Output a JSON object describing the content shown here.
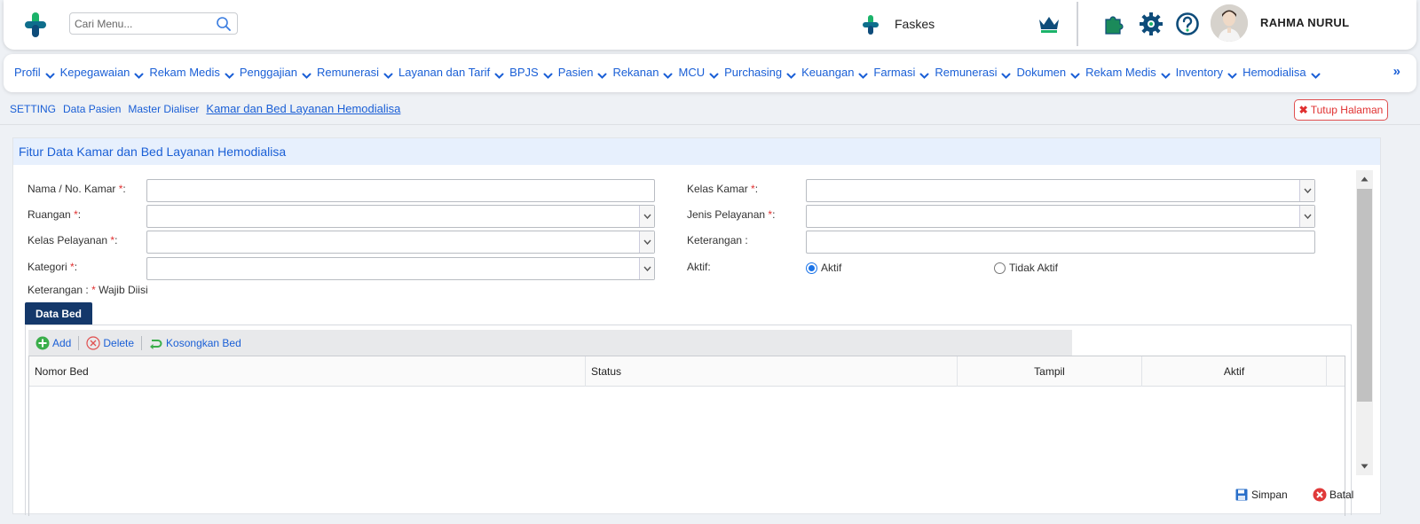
{
  "header": {
    "search_placeholder": "Cari Menu...",
    "facility_label": "Faskes",
    "user_name": "RAHMA NURUL"
  },
  "menu": {
    "items": [
      "Profil",
      "Kepegawaian",
      "Rekam Medis",
      "Penggajian",
      "Remunerasi",
      "Layanan dan Tarif",
      "BPJS",
      "Pasien",
      "Rekanan",
      "MCU",
      "Purchasing",
      "Keuangan",
      "Farmasi",
      "Remunerasi",
      "Dokumen",
      "Rekam Medis",
      "Inventory",
      "Hemodialisa"
    ],
    "more": "»"
  },
  "breadcrumb": {
    "items": [
      "SETTING",
      "Data Pasien",
      "Master Dialiser"
    ],
    "current": "Kamar dan Bed Layanan Hemodialisa"
  },
  "close_page": "Tutup Halaman",
  "panel": {
    "title": "Fitur Data Kamar dan Bed Layanan Hemodialisa"
  },
  "form": {
    "nama_kamar": "Nama / No. Kamar",
    "ruangan": "Ruangan",
    "kelas_pelayanan": "Kelas Pelayanan",
    "kategori": "Kategori",
    "kelas_kamar": "Kelas Kamar",
    "jenis_pelayanan": "Jenis Pelayanan",
    "keterangan": "Keterangan :",
    "aktif": "Aktif:",
    "radio_aktif": "Aktif",
    "radio_tidak_aktif": "Tidak Aktif",
    "required_mark": "*",
    "colon": ":",
    "note_prefix": "Keterangan :",
    "note_suffix": "Wajib Diisi"
  },
  "data_bed": {
    "tab_label": "Data Bed",
    "toolbar": {
      "add": "Add",
      "delete": "Delete",
      "kosongkan": "Kosongkan Bed"
    },
    "columns": [
      "Nomor Bed",
      "Status",
      "Tampil",
      "Aktif"
    ],
    "rows": []
  },
  "footer": {
    "save": "Simpan",
    "cancel": "Batal"
  },
  "colors": {
    "brand_green": "#1bb36a",
    "brand_blue": "#0e4c7a",
    "link_blue": "#1a5fd6",
    "tab_navy": "#14386a",
    "danger": "#e03030"
  }
}
